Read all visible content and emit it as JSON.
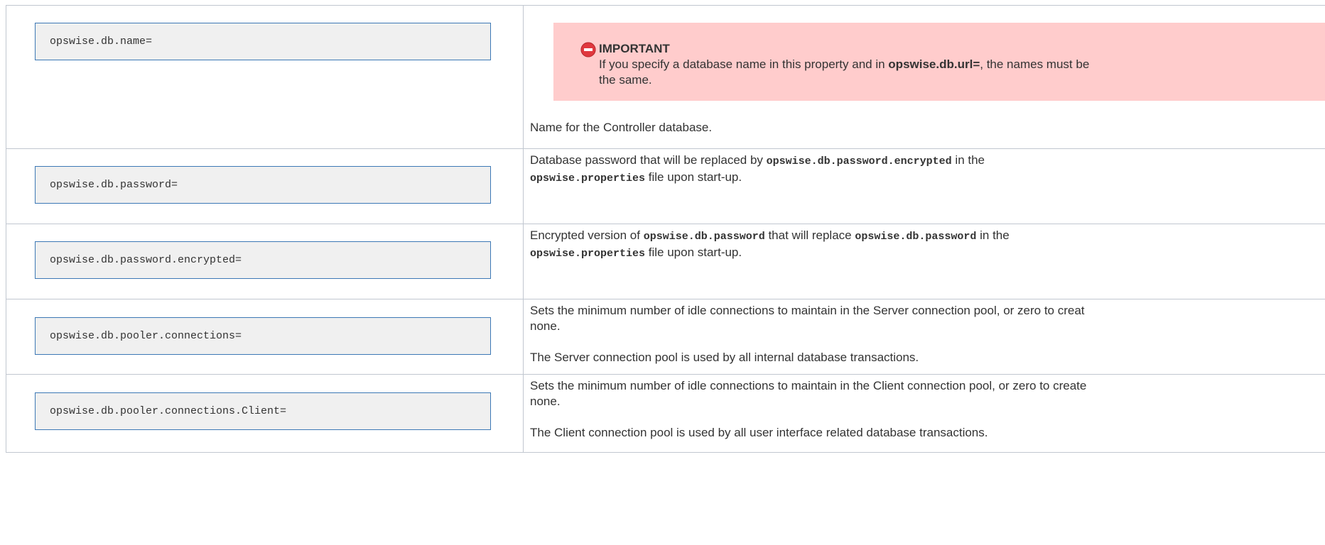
{
  "rows": [
    {
      "key": "opswise.db.name=",
      "alert": {
        "icon": "forbidden-icon",
        "title": "IMPORTANT",
        "text_pre": "If you specify a database name in this property and in ",
        "text_bold": "opswise.db.url=",
        "text_mid": ", the names must be",
        "text_line2": "the same."
      },
      "description": "Name for the Controller database."
    },
    {
      "key": "opswise.db.password=",
      "line1_pre": "Database password that will be replaced by ",
      "line1_code": "opswise.db.password.encrypted",
      "line1_post": " in the",
      "line2_code": "opswise.properties",
      "line2_post": " file upon start-up."
    },
    {
      "key": "opswise.db.password.encrypted=",
      "line1_pre": "Encrypted version of ",
      "line1_code": "opswise.db.password",
      "line1_mid": " that will replace ",
      "line1_code2": "opswise.db.password",
      "line1_post": " in the",
      "line2_code": "opswise.properties",
      "line2_post": " file upon start-up."
    },
    {
      "key": "opswise.db.pooler.connections=",
      "line1": "Sets the minimum number of idle connections to maintain in the Server connection pool, or zero to creat",
      "line2": "none.",
      "para2": "The Server connection pool is used by all internal database transactions."
    },
    {
      "key": "opswise.db.pooler.connections.Client=",
      "line1": "Sets the minimum number of idle connections to maintain in the Client connection pool, or zero to create",
      "line2": "none.",
      "para2": "The Client connection pool is used by all user interface related database transactions."
    }
  ],
  "colors": {
    "alert_background": "#ffcccc",
    "alert_icon": "#e0383e",
    "code_border": "#3c78b5",
    "code_background": "#f0f0f0",
    "table_border": "#c1c7d0"
  }
}
